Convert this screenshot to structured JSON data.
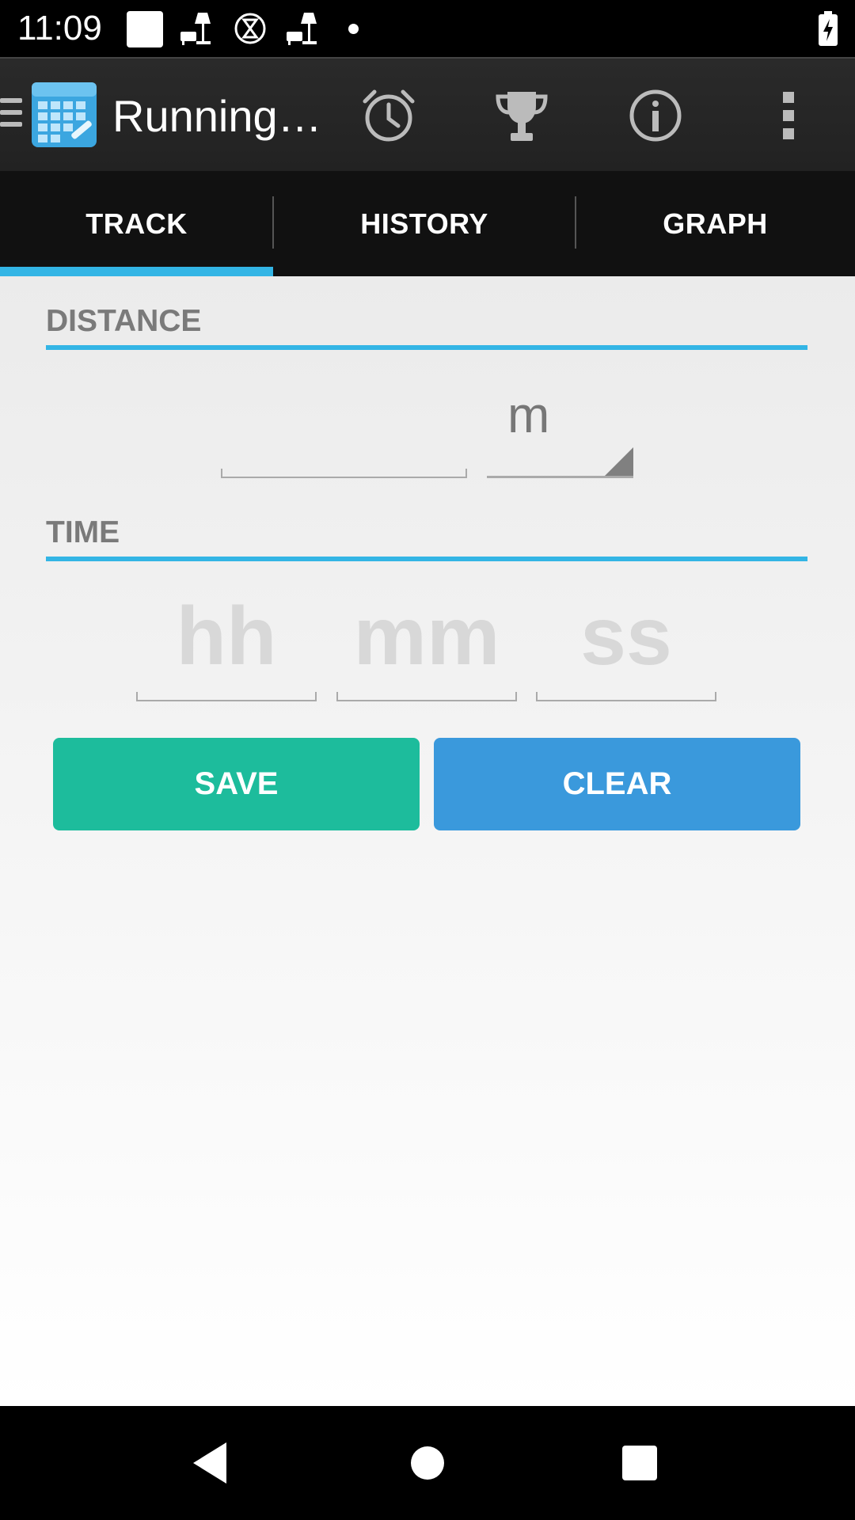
{
  "status_bar": {
    "time": "11:09",
    "icons": [
      "square-notification-icon",
      "lamp-icon",
      "hourglass-icon",
      "lamp-icon",
      "dot-icon",
      "battery-charging-icon"
    ]
  },
  "action_bar": {
    "title": "Running…",
    "icons": [
      "drawer-icon",
      "app-logo-icon",
      "alarm-clock-icon",
      "trophy-icon",
      "info-icon",
      "overflow-menu-icon"
    ]
  },
  "tabs": [
    {
      "label": "TRACK",
      "selected": true
    },
    {
      "label": "HISTORY",
      "selected": false
    },
    {
      "label": "GRAPH",
      "selected": false
    }
  ],
  "distance": {
    "header": "DISTANCE",
    "value": "",
    "unit": "m"
  },
  "time": {
    "header": "TIME",
    "hours_placeholder": "hh",
    "minutes_placeholder": "mm",
    "seconds_placeholder": "ss"
  },
  "buttons": {
    "save": "SAVE",
    "clear": "CLEAR"
  },
  "colors": {
    "accent": "#33b5e5",
    "save": "#1dbc9c",
    "clear": "#3a99dc"
  },
  "nav_bar": {
    "icons": [
      "back-icon",
      "home-icon",
      "recents-icon"
    ]
  }
}
